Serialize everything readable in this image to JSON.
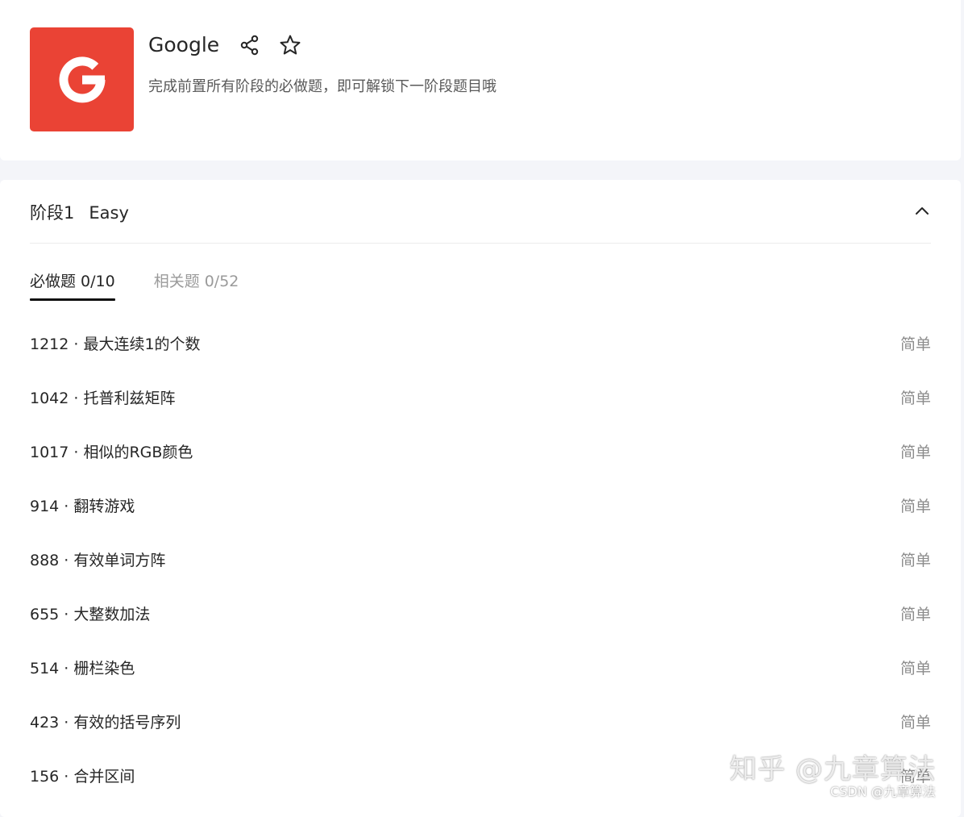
{
  "company": {
    "logo_letter": "G",
    "logo_color": "#ea4335",
    "title": "Google",
    "subtitle": "完成前置所有阶段的必做题，即可解锁下一阶段题目哦",
    "icons": [
      "share-icon",
      "star-icon"
    ]
  },
  "stage": {
    "title": "阶段1",
    "level": "Easy",
    "collapse_icon": "chevron-up-icon",
    "tabs": [
      {
        "label": "必做题",
        "count": "0/10",
        "active": true
      },
      {
        "label": "相关题",
        "count": "0/52",
        "active": false
      }
    ],
    "problems": [
      {
        "name": "1212 · 最大连续1的个数",
        "difficulty": "简单"
      },
      {
        "name": "1042 · 托普利兹矩阵",
        "difficulty": "简单"
      },
      {
        "name": "1017 · 相似的RGB颜色",
        "difficulty": "简单"
      },
      {
        "name": "914 · 翻转游戏",
        "difficulty": "简单"
      },
      {
        "name": "888 · 有效单词方阵",
        "difficulty": "简单"
      },
      {
        "name": "655 · 大整数加法",
        "difficulty": "简单"
      },
      {
        "name": "514 · 栅栏染色",
        "difficulty": "简单"
      },
      {
        "name": "423 · 有效的括号序列",
        "difficulty": "简单"
      },
      {
        "name": "156 · 合并区间",
        "difficulty": "简单"
      }
    ]
  },
  "watermarks": {
    "zhihu": "知乎 @九章算法",
    "csdn": "CSDN @九章算法"
  }
}
